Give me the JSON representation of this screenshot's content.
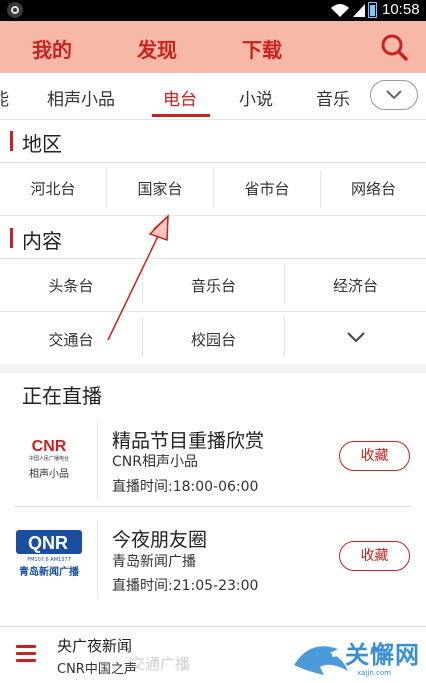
{
  "status_bar": {
    "time": "10:58"
  },
  "top_tabs": [
    "我的",
    "发现",
    "下载"
  ],
  "category_tabs": [
    {
      "label": "能",
      "active": false
    },
    {
      "label": "相声小品",
      "active": false
    },
    {
      "label": "电台",
      "active": true
    },
    {
      "label": "小说",
      "active": false
    },
    {
      "label": "音乐",
      "active": false
    }
  ],
  "region": {
    "title": "地区",
    "items": [
      "河北台",
      "国家台",
      "省市台",
      "网络台"
    ]
  },
  "content": {
    "title": "内容",
    "row1": [
      "头条台",
      "音乐台",
      "经济台"
    ],
    "row2": [
      "交通台",
      "校园台"
    ]
  },
  "live": {
    "title": "正在直播",
    "items": [
      {
        "name": "精品节目重播欣赏",
        "station": "CNR相声小品",
        "time": "直播时间:18:00-06:00",
        "button": "收藏",
        "logo_text": "CNR",
        "logo_sub": "中国人民广播电台",
        "logo_caption": "相声小品"
      },
      {
        "name": "今夜朋友圈",
        "station": "青岛新闻广播",
        "time": "直播时间:21:05-23:00",
        "button": "收藏",
        "logo_text": "QNR",
        "logo_sub": "FM107.6  AM1377",
        "logo_caption": "青岛新闻广播"
      }
    ]
  },
  "player": {
    "title": "央广夜新闻",
    "subtitle": "CNR中国之声",
    "ghost": "交通广播"
  },
  "watermark": {
    "text": "关懈网",
    "sub": "xajjn.com"
  },
  "colors": {
    "accent": "#c8231f",
    "topbar": "#f7b8a8"
  }
}
